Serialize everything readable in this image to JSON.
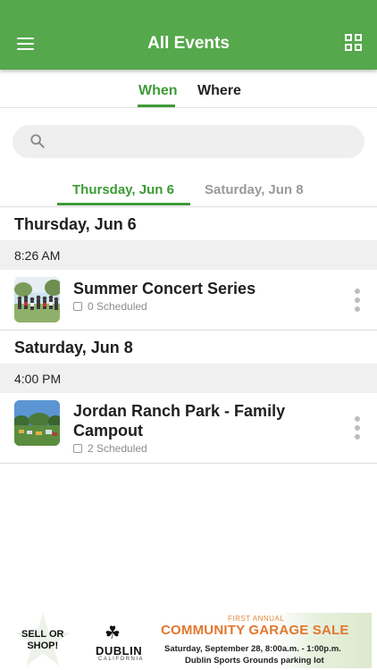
{
  "header": {
    "title": "All Events",
    "menu_icon": "menu-icon",
    "grid_icon": "grid-icon",
    "color": "#55a84b"
  },
  "view_tabs": [
    {
      "label": "When",
      "active": true
    },
    {
      "label": "Where",
      "active": false
    }
  ],
  "search": {
    "placeholder": "",
    "value": ""
  },
  "date_tabs": [
    {
      "label": "Thursday, Jun 6",
      "active": true
    },
    {
      "label": "Saturday, Jun 8",
      "active": false
    }
  ],
  "days": [
    {
      "heading": "Thursday, Jun 6",
      "time": "8:26 AM",
      "event": {
        "name": "Summer Concert Series",
        "scheduled": "0 Scheduled"
      }
    },
    {
      "heading": "Saturday, Jun 8",
      "time": "4:00 PM",
      "event": {
        "name": "Jordan Ranch Park - Family Campout",
        "scheduled": "2 Scheduled"
      }
    }
  ],
  "ad": {
    "sell_line1": "SELL OR",
    "sell_line2": "SHOP!",
    "city": "DUBLIN",
    "state": "CALIFORNIA",
    "first_annual": "FIRST ANNUAL",
    "headline": "COMMUNITY GARAGE SALE",
    "date_line": "Saturday, September 28, 8:00a.m. - 1:00p.m.",
    "location_line": "Dublin Sports Grounds parking lot"
  },
  "accent_color": "#3d9b37"
}
